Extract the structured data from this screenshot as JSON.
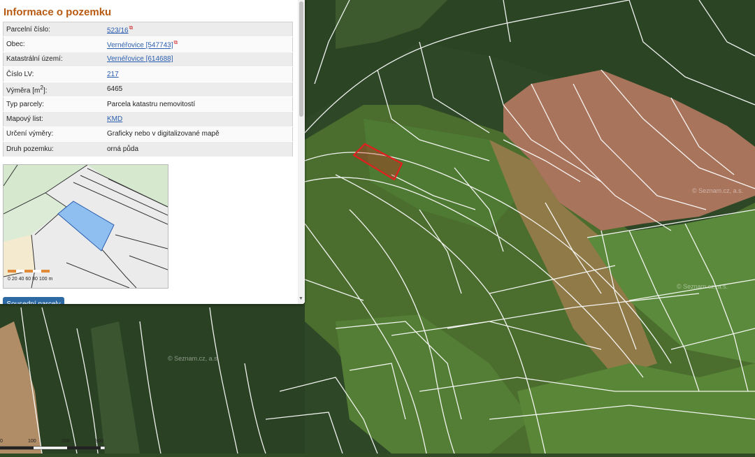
{
  "panel": {
    "title": "Informace o pozemku",
    "rows": [
      {
        "label": "Parcelní číslo:",
        "value": "523/16",
        "link": true,
        "external": true
      },
      {
        "label": "Obec:",
        "value": "Vernéřovice [547743]",
        "link": true,
        "external": true
      },
      {
        "label": "Katastrální území:",
        "value": "Vernéřovice [614688]",
        "link": true,
        "external": false
      },
      {
        "label": "Číslo LV:",
        "value": "217",
        "link": true,
        "external": false
      },
      {
        "label": "Výměra [m2]:",
        "value": "6465",
        "link": false,
        "external": false
      },
      {
        "label": "Typ parcely:",
        "value": "Parcela katastru nemovitostí",
        "link": false,
        "external": false
      },
      {
        "label": "Mapový list:",
        "value": "KMD",
        "link": true,
        "external": false
      },
      {
        "label": "Určení výměry:",
        "value": "Graficky nebo v digitalizované mapě",
        "link": false,
        "external": false
      },
      {
        "label": "Druh pozemku:",
        "value": "orná půda",
        "link": false,
        "external": false
      }
    ],
    "neighbours_button": "Sousední parcely"
  },
  "mini_map": {
    "scale_labels": [
      "0",
      "20",
      "40",
      "60",
      "80",
      "100 m"
    ]
  },
  "map": {
    "scale_labels": [
      "0",
      "100",
      "200",
      "300"
    ],
    "watermarks": [
      "© Seznam.cz, a.s.",
      "© Seznam.cz, a.s.",
      "© Seznam.cz, a.s."
    ]
  },
  "colors": {
    "title": "#b85a12",
    "link": "#2a5db0",
    "button": "#2d6aa3",
    "highlight_parcel": "#e02020",
    "mini_map_parcel": "#8fbff0"
  },
  "icons": {
    "external_link": "external-link-icon",
    "scroll_down": "scroll-down-icon"
  }
}
